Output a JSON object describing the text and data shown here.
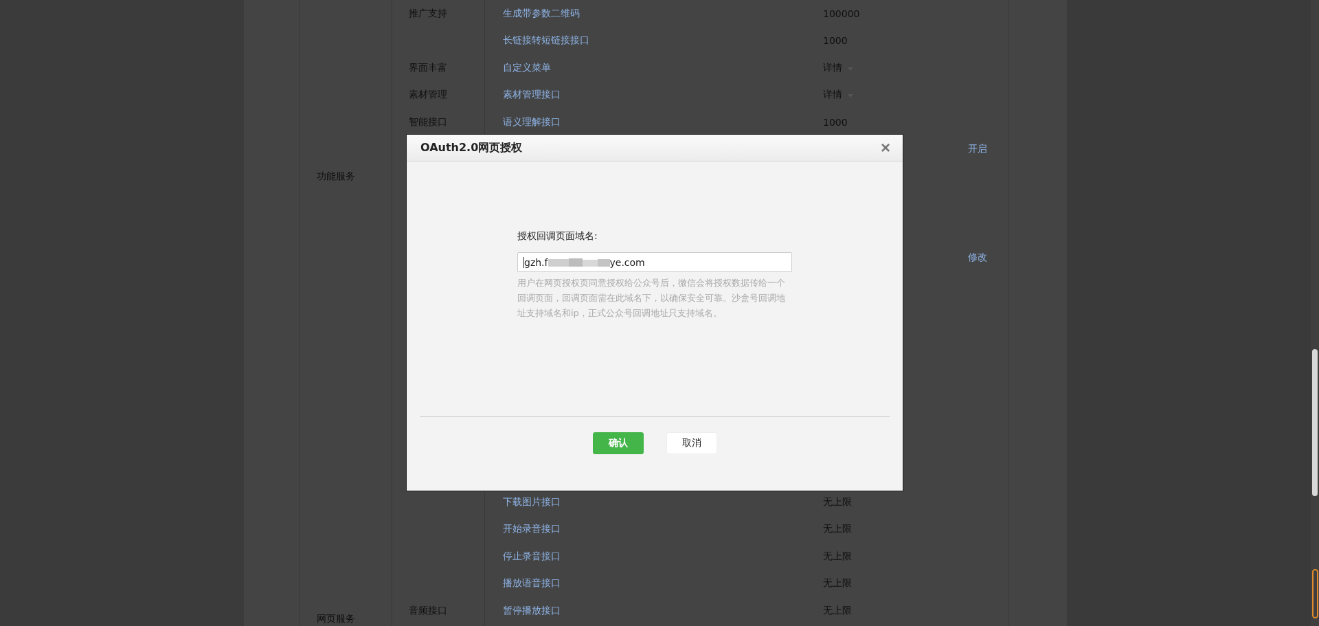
{
  "table": {
    "upper_rows": [
      {
        "category": "推广支持",
        "interface": "生成带参数二维码",
        "quota": "100000"
      },
      {
        "interface": "长链接转短链接接口",
        "quota": "1000"
      },
      {
        "category": "界面丰富",
        "interface": "自定义菜单",
        "quota": "详情",
        "expandable": true
      },
      {
        "category": "素材管理",
        "interface": "素材管理接口",
        "quota": "详情",
        "expandable": true
      },
      {
        "category": "智能接口",
        "interface": "语义理解接口",
        "quota": "1000"
      }
    ],
    "group_label": "功能服务",
    "side_actions": [
      "开启",
      "修改"
    ],
    "lower_rows": [
      {
        "interface": "下载图片接口",
        "quota": "无上限"
      },
      {
        "interface": "开始录音接口",
        "quota": "无上限"
      },
      {
        "interface": "停止录音接口",
        "quota": "无上限"
      },
      {
        "interface": "播放语音接口",
        "quota": "无上限"
      },
      {
        "category": "音频接口",
        "interface": "暂停播放接口",
        "quota": "无上限"
      }
    ],
    "last_group_label": "网页服务"
  },
  "dialog": {
    "title": "OAuth2.0网页授权",
    "close": "×",
    "field_label": "授权回调页面域名:",
    "field_value_start": "gzh.f",
    "field_value_end": "ye.com",
    "help": "用户在网页授权页同意授权给公众号后，微信会将授权数据传给一个回调页面，回调页面需在此域名下，以确保安全可靠。沙盒号回调地址支持域名和ip，正式公众号回调地址只支持域名。",
    "buttons": [
      {
        "label": "确认",
        "kind": "primary"
      },
      {
        "label": "取消",
        "kind": "default"
      }
    ]
  }
}
